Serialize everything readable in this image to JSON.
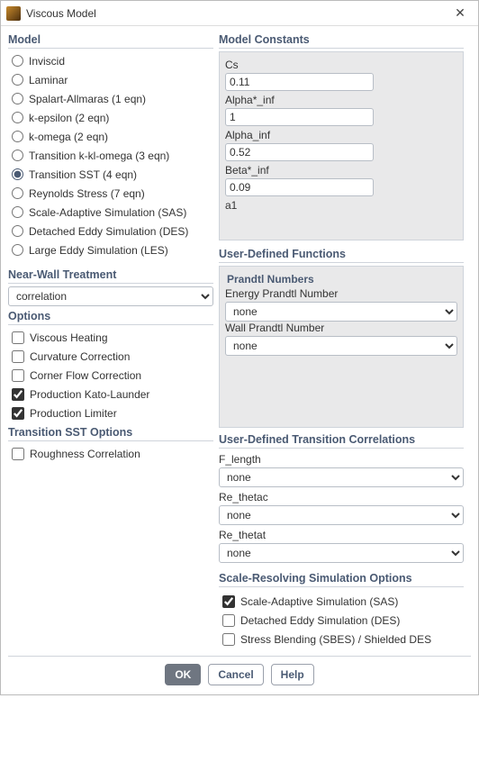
{
  "window": {
    "title": "Viscous Model"
  },
  "model": {
    "title": "Model",
    "items": [
      {
        "label": "Inviscid",
        "checked": false
      },
      {
        "label": "Laminar",
        "checked": false
      },
      {
        "label": "Spalart-Allmaras (1 eqn)",
        "checked": false
      },
      {
        "label": "k-epsilon (2 eqn)",
        "checked": false
      },
      {
        "label": "k-omega (2 eqn)",
        "checked": false
      },
      {
        "label": "Transition k-kl-omega (3 eqn)",
        "checked": false
      },
      {
        "label": "Transition SST (4 eqn)",
        "checked": true
      },
      {
        "label": "Reynolds Stress (7 eqn)",
        "checked": false
      },
      {
        "label": "Scale-Adaptive Simulation (SAS)",
        "checked": false
      },
      {
        "label": "Detached Eddy Simulation (DES)",
        "checked": false
      },
      {
        "label": "Large Eddy Simulation (LES)",
        "checked": false
      }
    ]
  },
  "near_wall": {
    "title": "Near-Wall Treatment",
    "value": "correlation"
  },
  "options": {
    "title": "Options",
    "items": [
      {
        "label": "Viscous Heating",
        "checked": false
      },
      {
        "label": "Curvature Correction",
        "checked": false
      },
      {
        "label": "Corner Flow Correction",
        "checked": false
      },
      {
        "label": "Production Kato-Launder",
        "checked": true
      },
      {
        "label": "Production Limiter",
        "checked": true
      }
    ]
  },
  "tsst": {
    "title": "Transition SST Options",
    "items": [
      {
        "label": "Roughness Correlation",
        "checked": false
      }
    ]
  },
  "constants": {
    "title": "Model Constants",
    "items": [
      {
        "label": "Cs",
        "value": "0.11"
      },
      {
        "label": "Alpha*_inf",
        "value": "1"
      },
      {
        "label": "Alpha_inf",
        "value": "0.52"
      },
      {
        "label": "Beta*_inf",
        "value": "0.09"
      },
      {
        "label": "a1",
        "value": ""
      }
    ]
  },
  "udf": {
    "title": "User-Defined Functions",
    "subtitle": "Prandtl Numbers",
    "items": [
      {
        "label": "Energy Prandtl Number",
        "value": "none"
      },
      {
        "label": "Wall Prandtl Number",
        "value": "none"
      }
    ]
  },
  "udtc": {
    "title": "User-Defined Transition Correlations",
    "items": [
      {
        "label": "F_length",
        "value": "none"
      },
      {
        "label": "Re_thetac",
        "value": "none"
      },
      {
        "label": "Re_thetat",
        "value": "none"
      }
    ]
  },
  "srs": {
    "title": "Scale-Resolving Simulation Options",
    "items": [
      {
        "label": "Scale-Adaptive Simulation (SAS)",
        "checked": true
      },
      {
        "label": "Detached Eddy Simulation (DES)",
        "checked": false
      },
      {
        "label": "Stress Blending (SBES) / Shielded DES",
        "checked": false
      }
    ]
  },
  "footer": {
    "ok": "OK",
    "cancel": "Cancel",
    "help": "Help"
  }
}
